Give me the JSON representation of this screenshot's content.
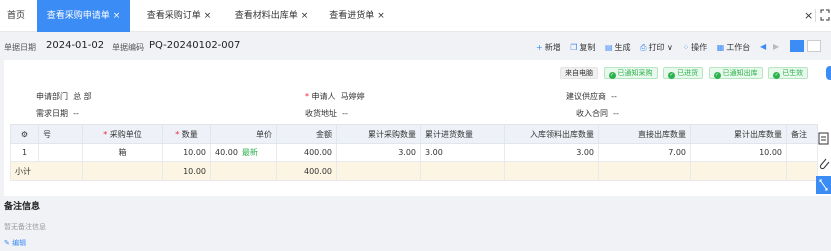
{
  "tabs": {
    "home": "首页",
    "items": [
      {
        "label": "查看采购申请单",
        "active": true
      },
      {
        "label": "查看采购订单",
        "active": false
      },
      {
        "label": "查看材料出库单",
        "active": false
      },
      {
        "label": "查看进货单",
        "active": false
      }
    ],
    "close_glyph": "×"
  },
  "doc": {
    "date_label": "单据日期",
    "date_value": "2024-01-02",
    "code_label": "单据编码",
    "code_value": "PQ-20240102-007"
  },
  "toolbar": {
    "add": "新增",
    "copy": "复制",
    "generate": "生成",
    "print": "打印",
    "operate": "操作",
    "workbench": "工作台"
  },
  "status_badges": {
    "source": "来自电脑",
    "notified_purchase": "已通知采购",
    "stocked_in": "已进货",
    "notified_out": "已通知出库",
    "effective": "已生效"
  },
  "info": {
    "dept_label": "申请部门",
    "dept_value": "总 部",
    "applicant_label": "申请人",
    "applicant_value": "马婷婷",
    "supplier_label": "建议供应商",
    "supplier_value": "--",
    "need_date_label": "需求日期",
    "need_date_value": "--",
    "address_label": "收货地址",
    "address_value": "--",
    "contract_label": "收入合同",
    "contract_value": "--"
  },
  "table": {
    "headers": {
      "settings": "⚙",
      "no": "号",
      "unit": "采购单位",
      "qty": "数量",
      "price": "单价",
      "amount": "金额",
      "purchased": "累计采购数量",
      "stocked": "累计进货数量",
      "inbound_out": "入库领料出库数量",
      "direct_in": "直接出库数量",
      "out_total": "累计出库数量",
      "remark": "备注"
    },
    "rows": [
      {
        "no": "1",
        "unit": "箱",
        "qty": "10.00",
        "price": "40.00",
        "latest": "最新",
        "amount": "400.00",
        "purchased": "3.00",
        "stocked": "3.00",
        "inbound_out": "3.00",
        "direct_in": "7.00",
        "out_total": "10.00",
        "remark": ""
      }
    ],
    "subtotal": {
      "label": "小计",
      "qty": "10.00",
      "amount": "400.00"
    }
  },
  "remark": {
    "title": "备注信息",
    "empty": "暂无备注信息",
    "edit": "编辑"
  },
  "colors": {
    "accent": "#3c8cf5",
    "success": "#2bb24c",
    "subtotal_bg": "#fdf5e3"
  }
}
